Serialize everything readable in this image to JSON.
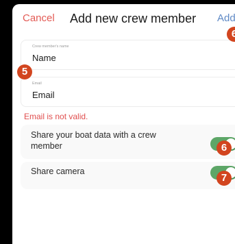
{
  "header": {
    "cancel_label": "Cancel",
    "title": "Add new crew member",
    "add_label": "Add"
  },
  "fields": {
    "name": {
      "label": "Crew member's name",
      "value": "Name"
    },
    "email": {
      "label": "Email",
      "value": "Email"
    }
  },
  "error_text": "Email is not valid.",
  "toggles": [
    {
      "label_line1": "Share your boat data with a crew",
      "label_line2": "member",
      "on": true
    },
    {
      "label": "Share camera",
      "on": true
    }
  ],
  "badges": [
    "6",
    "5",
    "6",
    "7"
  ],
  "colors": {
    "cancel": "#e35b55",
    "add": "#5e89c5",
    "error": "#e04e4e",
    "toggle_on": "#5da667",
    "badge": "#d2451f"
  }
}
